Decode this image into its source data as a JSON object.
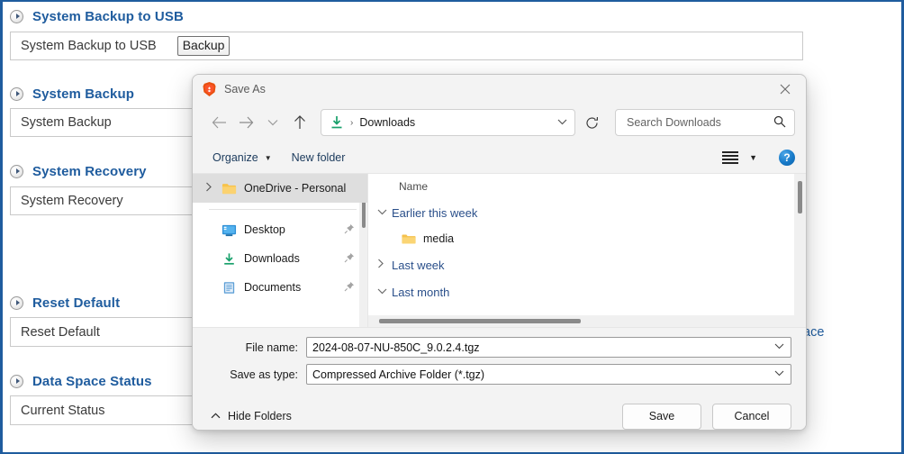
{
  "background_page": {
    "accent_color": "#1f5c9e",
    "sections": [
      {
        "title": "System Backup to USB",
        "row_label": "System Backup to USB",
        "button": "Backup"
      },
      {
        "title": "System Backup",
        "row_label": "System Backup"
      },
      {
        "title": "System Recovery",
        "row_label": "System Recovery"
      },
      {
        "title": "Reset Default",
        "row_label": "Reset Default",
        "right_text": "ace"
      },
      {
        "title": "Data Space Status",
        "row_label": "Current Status"
      }
    ]
  },
  "dialog": {
    "title": "Save As",
    "app_icon": "brave-lion-icon",
    "close_icon": "close-icon",
    "nav": {
      "back_icon": "back-arrow-icon",
      "forward_icon": "forward-arrow-icon",
      "recent_icon": "chevron-down-icon",
      "up_icon": "up-arrow-icon",
      "breadcrumb_icon": "downloads-icon",
      "breadcrumb_separator": "›",
      "breadcrumb": "Downloads",
      "breadcrumb_chevron": "chevron-down-icon",
      "refresh_icon": "refresh-icon"
    },
    "search": {
      "placeholder": "Search Downloads",
      "value": "",
      "icon": "search-icon"
    },
    "toolbar": {
      "organize": "Organize",
      "organize_caret": "▼",
      "new_folder": "New folder",
      "view_icon": "list-view-icon",
      "view_caret": "▼",
      "help_icon": "help-icon",
      "help_label": "?"
    },
    "nav_pane": {
      "tree_item": {
        "label": "OneDrive - Personal",
        "icon": "folder-icon",
        "expand_icon": "chevron-right-icon",
        "selected": true
      },
      "quick_access": [
        {
          "label": "Desktop",
          "icon": "desktop-icon",
          "pin_icon": "pin-icon"
        },
        {
          "label": "Downloads",
          "icon": "downloads-icon",
          "pin_icon": "pin-icon"
        },
        {
          "label": "Documents",
          "icon": "documents-icon",
          "pin_icon": "pin-icon"
        }
      ]
    },
    "file_pane": {
      "column_header": "Name",
      "groups": [
        {
          "label": "Earlier this week",
          "expanded": true,
          "chevron": "chevron-down-icon",
          "items": [
            {
              "name": "media",
              "icon": "folder-icon"
            }
          ]
        },
        {
          "label": "Last week",
          "expanded": false,
          "chevron": "chevron-right-icon",
          "items": []
        },
        {
          "label": "Last month",
          "expanded": true,
          "chevron": "chevron-down-icon",
          "items": []
        }
      ]
    },
    "form": {
      "file_name_label": "File name:",
      "file_name_value": "2024-08-07-NU-850C_9.0.2.4.tgz",
      "save_as_type_label": "Save as type:",
      "save_as_type_value": "Compressed Archive Folder (*.tgz)",
      "dropdown_icon": "chevron-down-icon"
    },
    "footer": {
      "hide_folders": "Hide Folders",
      "hide_folders_icon": "chevron-up-icon",
      "save": "Save",
      "cancel": "Cancel",
      "resize_grip_icon": "resize-grip-icon"
    }
  }
}
